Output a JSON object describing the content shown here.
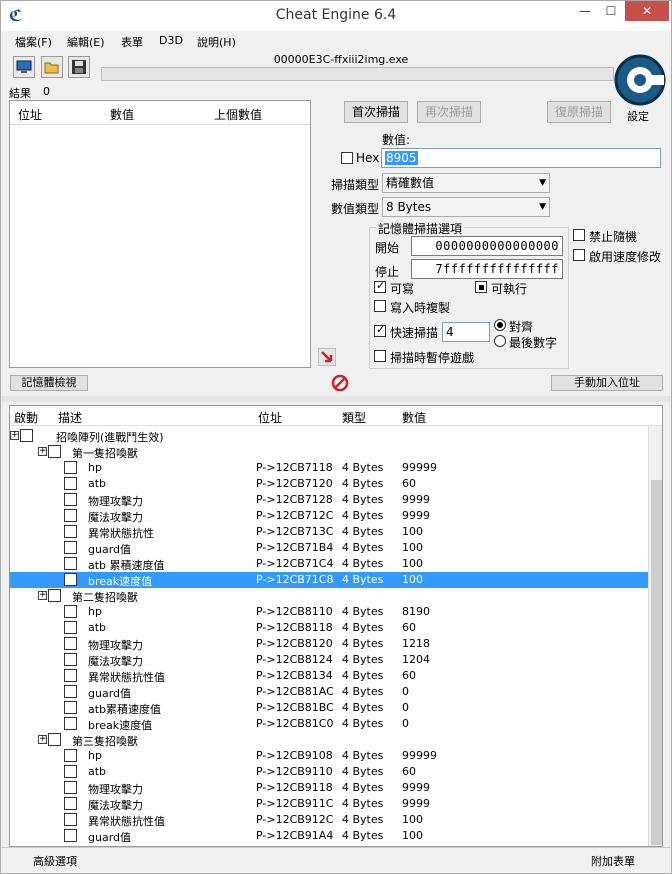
{
  "window": {
    "title": "Cheat Engine 6.4"
  },
  "menu": [
    "檔案(F)",
    "編輯(E)",
    "表單",
    "D3D",
    "說明(H)"
  ],
  "process": "00000E3C-ffxiii2img.exe",
  "results": {
    "label": "結果",
    "count": "0"
  },
  "result_columns": [
    "位址",
    "數值",
    "上個數值"
  ],
  "scan_buttons": {
    "first": "首次掃描",
    "next": "再次掃描",
    "undo": "復原掃描"
  },
  "settings_label": "設定",
  "value": {
    "label": "數值:",
    "hex_label": "Hex",
    "input": "8905"
  },
  "scan_type": {
    "label": "掃描類型",
    "selected": "精確數值"
  },
  "value_type": {
    "label": "數值類型",
    "selected": "8 Bytes"
  },
  "memory_options": {
    "title": "記憶體掃描選項",
    "start_label": "開始",
    "start": "0000000000000000",
    "stop_label": "停止",
    "stop": "7fffffffffffffff",
    "writable": "可寫",
    "executable": "可執行",
    "copy_on_write": "寫入時複製",
    "fast_scan": "快速掃描",
    "fast_scan_value": "4",
    "aligned": "對齊",
    "last_digits": "最後數字",
    "pause": "掃描時暫停遊戲"
  },
  "no_random": "禁止隨機",
  "speedhack": "啟用速度修改",
  "memory_view": "記憶體檢視",
  "add_address": "手動加入位址",
  "table_columns": [
    "啟動",
    "描述",
    "位址",
    "類型",
    "數值"
  ],
  "rows": [
    {
      "level": 0,
      "expander": true,
      "desc": "招喚陣列(進戰鬥生效)",
      "addr": "",
      "type": "",
      "val": ""
    },
    {
      "level": 1,
      "expander": true,
      "desc": "第一隻招喚獸",
      "addr": "",
      "type": "",
      "val": ""
    },
    {
      "level": 2,
      "desc": "hp",
      "addr": "P->12CB7118",
      "type": "4 Bytes",
      "val": "99999"
    },
    {
      "level": 2,
      "desc": "atb",
      "addr": "P->12CB7120",
      "type": "4 Bytes",
      "val": "60"
    },
    {
      "level": 2,
      "desc": "物理攻擊力",
      "addr": "P->12CB7128",
      "type": "4 Bytes",
      "val": "9999"
    },
    {
      "level": 2,
      "desc": "魔法攻擊力",
      "addr": "P->12CB712C",
      "type": "4 Bytes",
      "val": "9999"
    },
    {
      "level": 2,
      "desc": "異常狀態抗性",
      "addr": "P->12CB713C",
      "type": "4 Bytes",
      "val": "100"
    },
    {
      "level": 2,
      "desc": "guard值",
      "addr": "P->12CB71B4",
      "type": "4 Bytes",
      "val": "100"
    },
    {
      "level": 2,
      "desc": "atb 累積速度值",
      "addr": "P->12CB71C4",
      "type": "4 Bytes",
      "val": "100"
    },
    {
      "level": 2,
      "desc": "break速度值",
      "addr": "P->12CB71C8",
      "type": "4 Bytes",
      "val": "100",
      "selected": true
    },
    {
      "level": 1,
      "expander": true,
      "desc": "第二隻招喚獸",
      "addr": "",
      "type": "",
      "val": ""
    },
    {
      "level": 2,
      "desc": "hp",
      "addr": "P->12CB8110",
      "type": "4 Bytes",
      "val": "8190"
    },
    {
      "level": 2,
      "desc": "atb",
      "addr": "P->12CB8118",
      "type": "4 Bytes",
      "val": "60"
    },
    {
      "level": 2,
      "desc": "物理攻擊力",
      "addr": "P->12CB8120",
      "type": "4 Bytes",
      "val": "1218"
    },
    {
      "level": 2,
      "desc": "魔法攻擊力",
      "addr": "P->12CB8124",
      "type": "4 Bytes",
      "val": "1204"
    },
    {
      "level": 2,
      "desc": "異常狀態抗性值",
      "addr": "P->12CB8134",
      "type": "4 Bytes",
      "val": "60"
    },
    {
      "level": 2,
      "desc": "guard值",
      "addr": "P->12CB81AC",
      "type": "4 Bytes",
      "val": "0"
    },
    {
      "level": 2,
      "desc": "atb累積速度值",
      "addr": "P->12CB81BC",
      "type": "4 Bytes",
      "val": "0"
    },
    {
      "level": 2,
      "desc": "break速度值",
      "addr": "P->12CB81C0",
      "type": "4 Bytes",
      "val": "0"
    },
    {
      "level": 1,
      "expander": true,
      "desc": "第三隻招喚獸",
      "addr": "",
      "type": "",
      "val": ""
    },
    {
      "level": 2,
      "desc": "hp",
      "addr": "P->12CB9108",
      "type": "4 Bytes",
      "val": "99999"
    },
    {
      "level": 2,
      "desc": "atb",
      "addr": "P->12CB9110",
      "type": "4 Bytes",
      "val": "60"
    },
    {
      "level": 2,
      "desc": "物理攻擊力",
      "addr": "P->12CB9118",
      "type": "4 Bytes",
      "val": "9999"
    },
    {
      "level": 2,
      "desc": "魔法攻擊力",
      "addr": "P->12CB911C",
      "type": "4 Bytes",
      "val": "9999"
    },
    {
      "level": 2,
      "desc": "異常狀態抗性值",
      "addr": "P->12CB912C",
      "type": "4 Bytes",
      "val": "100"
    },
    {
      "level": 2,
      "desc": "guard值",
      "addr": "P->12CB91A4",
      "type": "4 Bytes",
      "val": "100"
    }
  ],
  "status": {
    "advanced": "高級選項",
    "table_extras": "附加表單"
  },
  "colors": {
    "selection": "#3399ff",
    "close": "#c7504a"
  }
}
